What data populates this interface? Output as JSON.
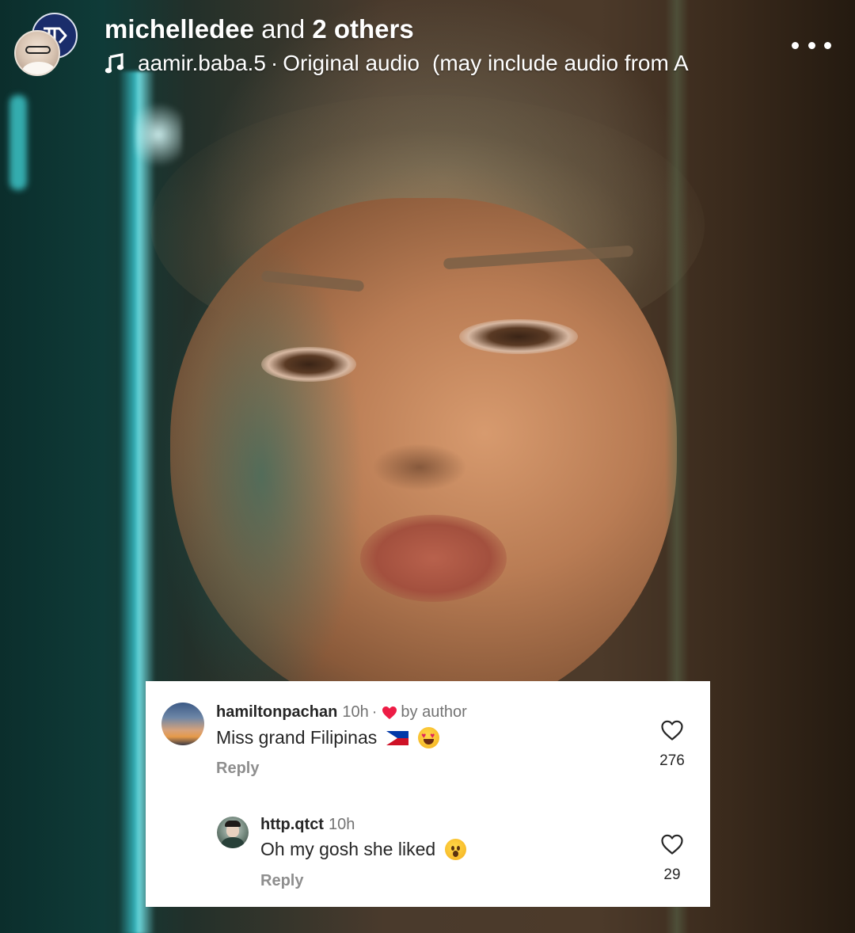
{
  "header": {
    "username": "michelledee",
    "joiner": "and",
    "others": "2 others",
    "audio_author": "aamir.baba.5",
    "audio_separator": "·",
    "audio_title": "Original audio",
    "audio_note": "(may include audio from A",
    "icons": [
      "music-note-icon",
      "more-options-icon"
    ]
  },
  "comments": [
    {
      "username": "hamiltonpachan",
      "time": "10h",
      "separator": "·",
      "liked_by": "by author",
      "text": "Miss grand Filipinas",
      "emojis": [
        "philippines-flag",
        "heart-eyes-face"
      ],
      "reply_label": "Reply",
      "likes": "276"
    },
    {
      "username": "http.qtct",
      "time": "10h",
      "text": "Oh my gosh she liked",
      "emojis": [
        "surprised-face"
      ],
      "reply_label": "Reply",
      "likes": "29"
    }
  ],
  "colors": {
    "card_bg": "#ffffff",
    "text_primary": "#262626",
    "text_secondary": "#737373",
    "liked_heart": "#ed1c45",
    "badge_bg": "#1a2d6b"
  }
}
